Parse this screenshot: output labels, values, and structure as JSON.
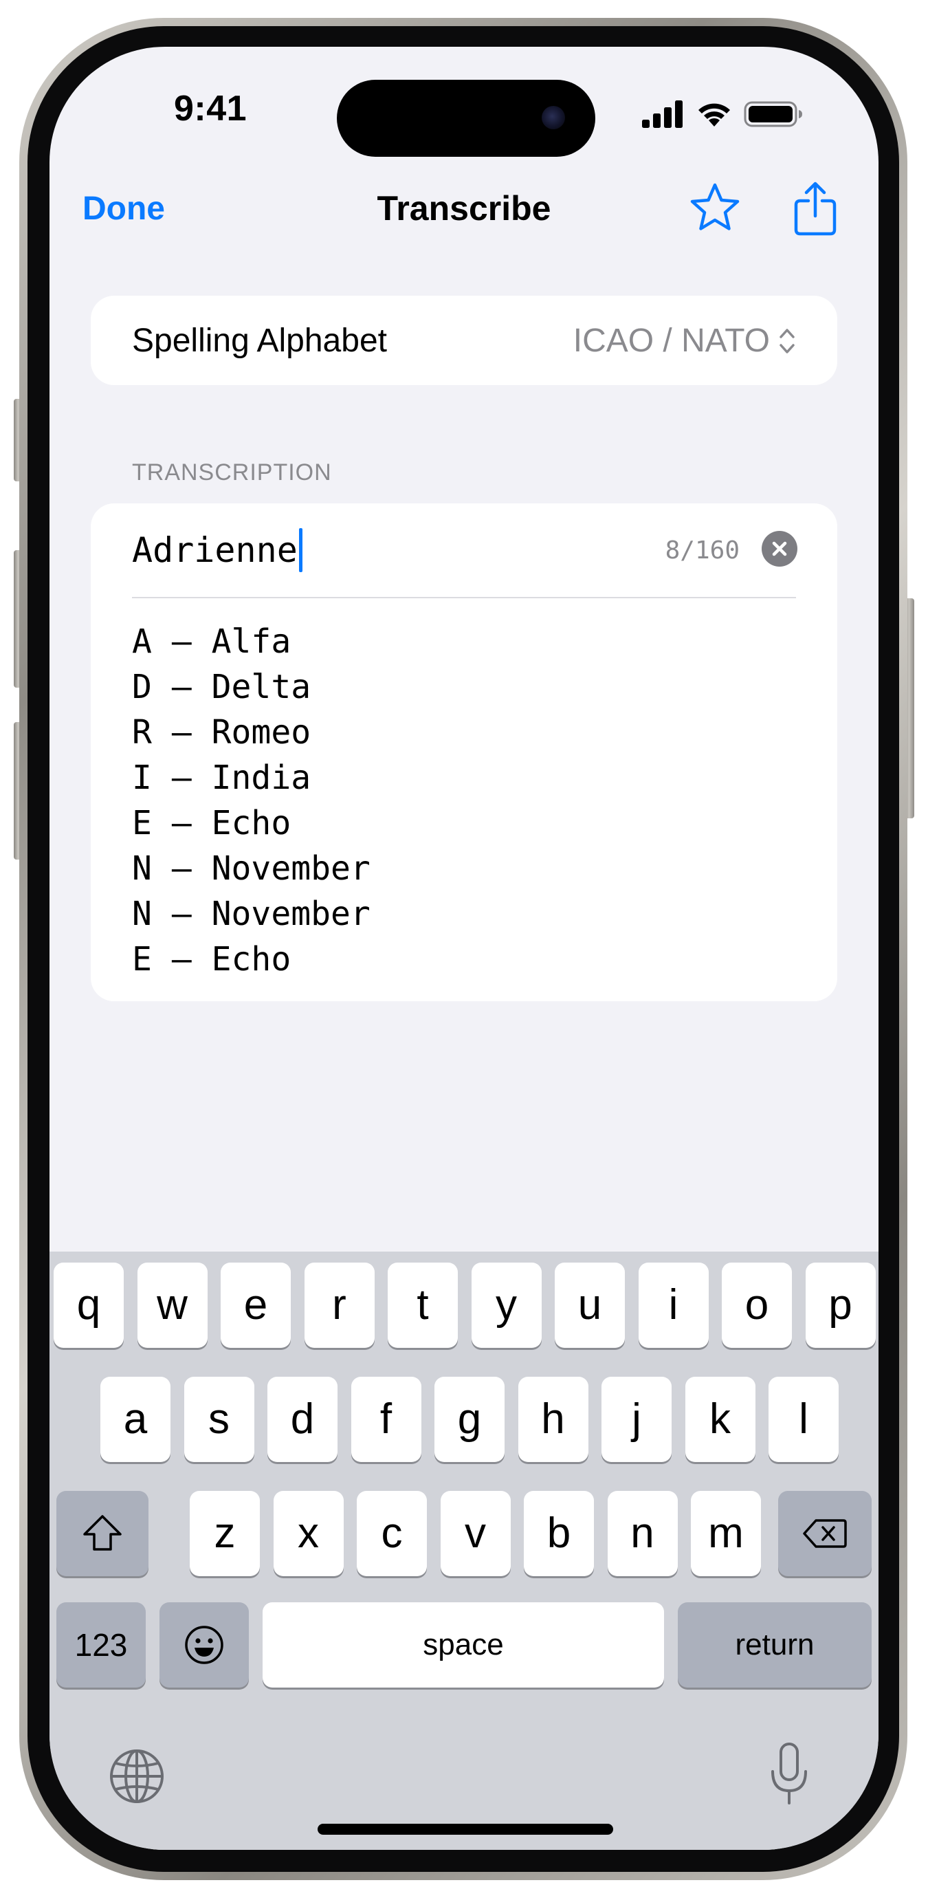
{
  "status_bar": {
    "time": "9:41"
  },
  "nav": {
    "done_label": "Done",
    "title": "Transcribe",
    "star_icon": "star-outline-icon",
    "share_icon": "share-icon",
    "accent_color": "#0A7AFF"
  },
  "alphabet": {
    "label": "Spelling Alphabet",
    "value": "ICAO / NATO"
  },
  "transcription": {
    "section_header": "TRANSCRIPTION",
    "input_value": "Adrienne",
    "counter": "8/160",
    "lines": [
      {
        "letter": "A",
        "dash": "—",
        "word": "Alfa"
      },
      {
        "letter": "D",
        "dash": "—",
        "word": "Delta"
      },
      {
        "letter": "R",
        "dash": "—",
        "word": "Romeo"
      },
      {
        "letter": "I",
        "dash": "—",
        "word": "India"
      },
      {
        "letter": "E",
        "dash": "—",
        "word": "Echo"
      },
      {
        "letter": "N",
        "dash": "—",
        "word": "November"
      },
      {
        "letter": "N",
        "dash": "—",
        "word": "November"
      },
      {
        "letter": "E",
        "dash": "—",
        "word": "Echo"
      }
    ]
  },
  "keyboard": {
    "row1": [
      "q",
      "w",
      "e",
      "r",
      "t",
      "y",
      "u",
      "i",
      "o",
      "p"
    ],
    "row2": [
      "a",
      "s",
      "d",
      "f",
      "g",
      "h",
      "j",
      "k",
      "l"
    ],
    "row3": [
      "z",
      "x",
      "c",
      "v",
      "b",
      "n",
      "m"
    ],
    "numbers_label": "123",
    "space_label": "space",
    "return_label": "return"
  }
}
